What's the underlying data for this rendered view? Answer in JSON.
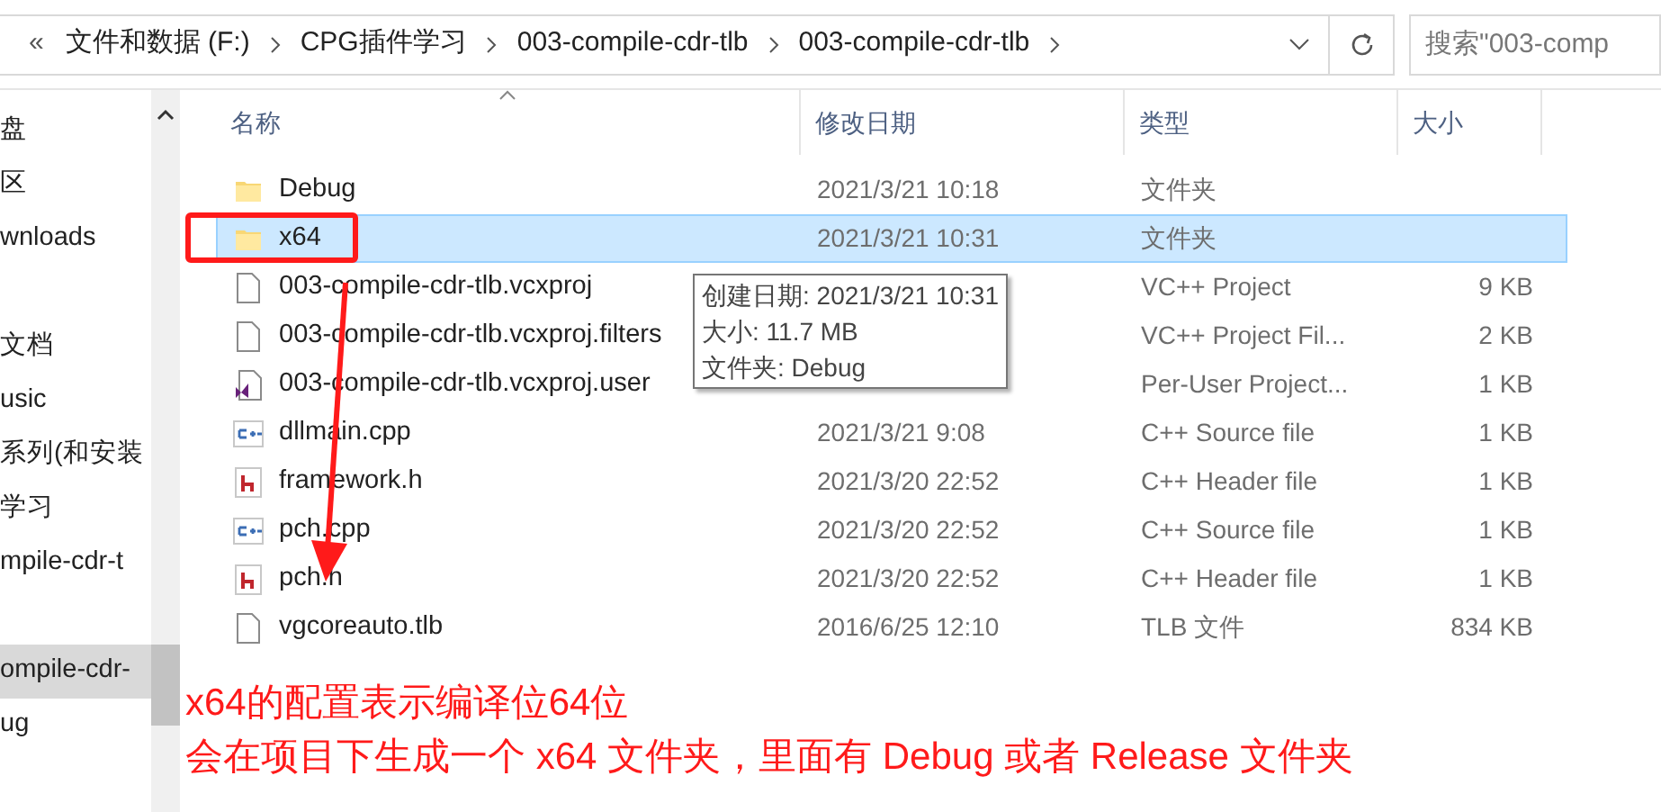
{
  "address_bar": {
    "overflow": "«",
    "crumbs": [
      "文件和数据 (F:)",
      "CPG插件学习",
      "003-compile-cdr-tlb",
      "003-compile-cdr-tlb"
    ],
    "search": {
      "placeholder": "搜索\"003-comp"
    }
  },
  "sidebar": {
    "items": [
      {
        "kind": "entry",
        "label": "盘",
        "selected": false
      },
      {
        "kind": "entry",
        "label": "区",
        "selected": false
      },
      {
        "kind": "entry",
        "label": "wnloads",
        "selected": false
      },
      {
        "kind": "group_start",
        "label": "文档",
        "selected": false
      },
      {
        "kind": "entry",
        "label": "usic",
        "selected": false
      },
      {
        "kind": "entry",
        "label": "系列(和安装",
        "selected": false
      },
      {
        "kind": "entry",
        "label": "学习",
        "selected": false
      },
      {
        "kind": "entry",
        "label": "mpile-cdr-t",
        "selected": false
      },
      {
        "kind": "group_start",
        "label": "ompile-cdr-",
        "selected": true
      },
      {
        "kind": "entry",
        "label": "ug",
        "selected": false
      }
    ]
  },
  "table": {
    "columns": [
      "名称",
      "修改日期",
      "类型",
      "大小"
    ],
    "rows": [
      {
        "kind": "folder",
        "name": "Debug",
        "date": "2021/3/21 10:18",
        "type": "文件夹",
        "selected": false
      },
      {
        "kind": "folder",
        "name": "x64",
        "date": "2021/3/21 10:31",
        "type": "文件夹",
        "selected": true
      },
      {
        "kind": "file",
        "name": "003-compile-cdr-tlb.vcxproj",
        "type": "VC++ Project",
        "size": "9 KB",
        "selected": false
      },
      {
        "kind": "file",
        "name": "003-compile-cdr-tlb.vcxproj.filters",
        "type": "VC++ Project Fil...",
        "size": "2 KB",
        "selected": false
      },
      {
        "kind": "vs",
        "name": "003-compile-cdr-tlb.vcxproj.user",
        "type": "Per-User Project...",
        "size": "1 KB",
        "selected": false
      },
      {
        "kind": "cpp",
        "name": "dllmain.cpp",
        "date": "2021/3/21 9:08",
        "type": "C++ Source file",
        "size": "1 KB",
        "selected": false
      },
      {
        "kind": "h",
        "name": "framework.h",
        "date": "2021/3/20 22:52",
        "type": "C++ Header file",
        "size": "1 KB",
        "selected": false
      },
      {
        "kind": "cpp",
        "name": "pch.cpp",
        "date": "2021/3/20 22:52",
        "type": "C++ Source file",
        "size": "1 KB",
        "selected": false
      },
      {
        "kind": "h",
        "name": "pch.h",
        "date": "2021/3/20 22:52",
        "type": "C++ Header file",
        "size": "1 KB",
        "selected": false
      },
      {
        "kind": "file",
        "name": "vgcoreauto.tlb",
        "date": "2016/6/25 12:10",
        "type": "TLB 文件",
        "size": "834 KB",
        "selected": false
      }
    ]
  },
  "tooltip": [
    "创建日期: 2021/3/21 10:31",
    "大小: 11.7 MB",
    "文件夹: Debug"
  ],
  "annotation": [
    "x64的配置表示编译位64位",
    "会在项目下生成一个 x64 文件夹，里面有 Debug 或者 Release 文件夹"
  ]
}
